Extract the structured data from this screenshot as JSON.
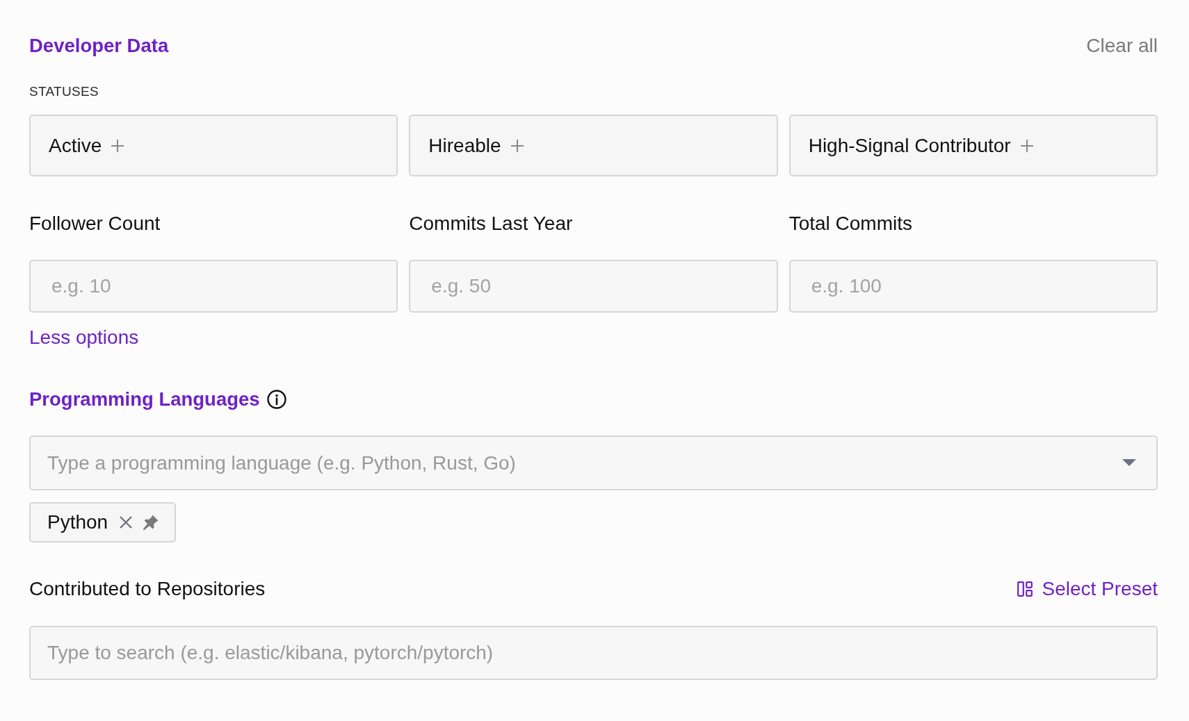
{
  "header": {
    "title": "Developer Data",
    "clear_all": "Clear all"
  },
  "statuses": {
    "label": "STATUSES",
    "options": [
      {
        "label": "Active",
        "selected": false
      },
      {
        "label": "Hireable",
        "selected": false
      },
      {
        "label": "High-Signal Contributor",
        "selected": false
      }
    ]
  },
  "numeric_filters": [
    {
      "label": "Follower Count",
      "placeholder": "e.g. 10"
    },
    {
      "label": "Commits Last Year",
      "placeholder": "e.g. 50"
    },
    {
      "label": "Total Commits",
      "placeholder": "e.g. 100"
    }
  ],
  "less_options": "Less options",
  "programming_languages": {
    "title": "Programming Languages",
    "placeholder": "Type a programming language (e.g. Python, Rust, Go)",
    "chips": [
      {
        "label": "Python"
      }
    ]
  },
  "repositories": {
    "label": "Contributed to Repositories",
    "preset_button": "Select Preset",
    "placeholder": "Type to search (e.g. elastic/kibana, pytorch/pytorch)"
  }
}
